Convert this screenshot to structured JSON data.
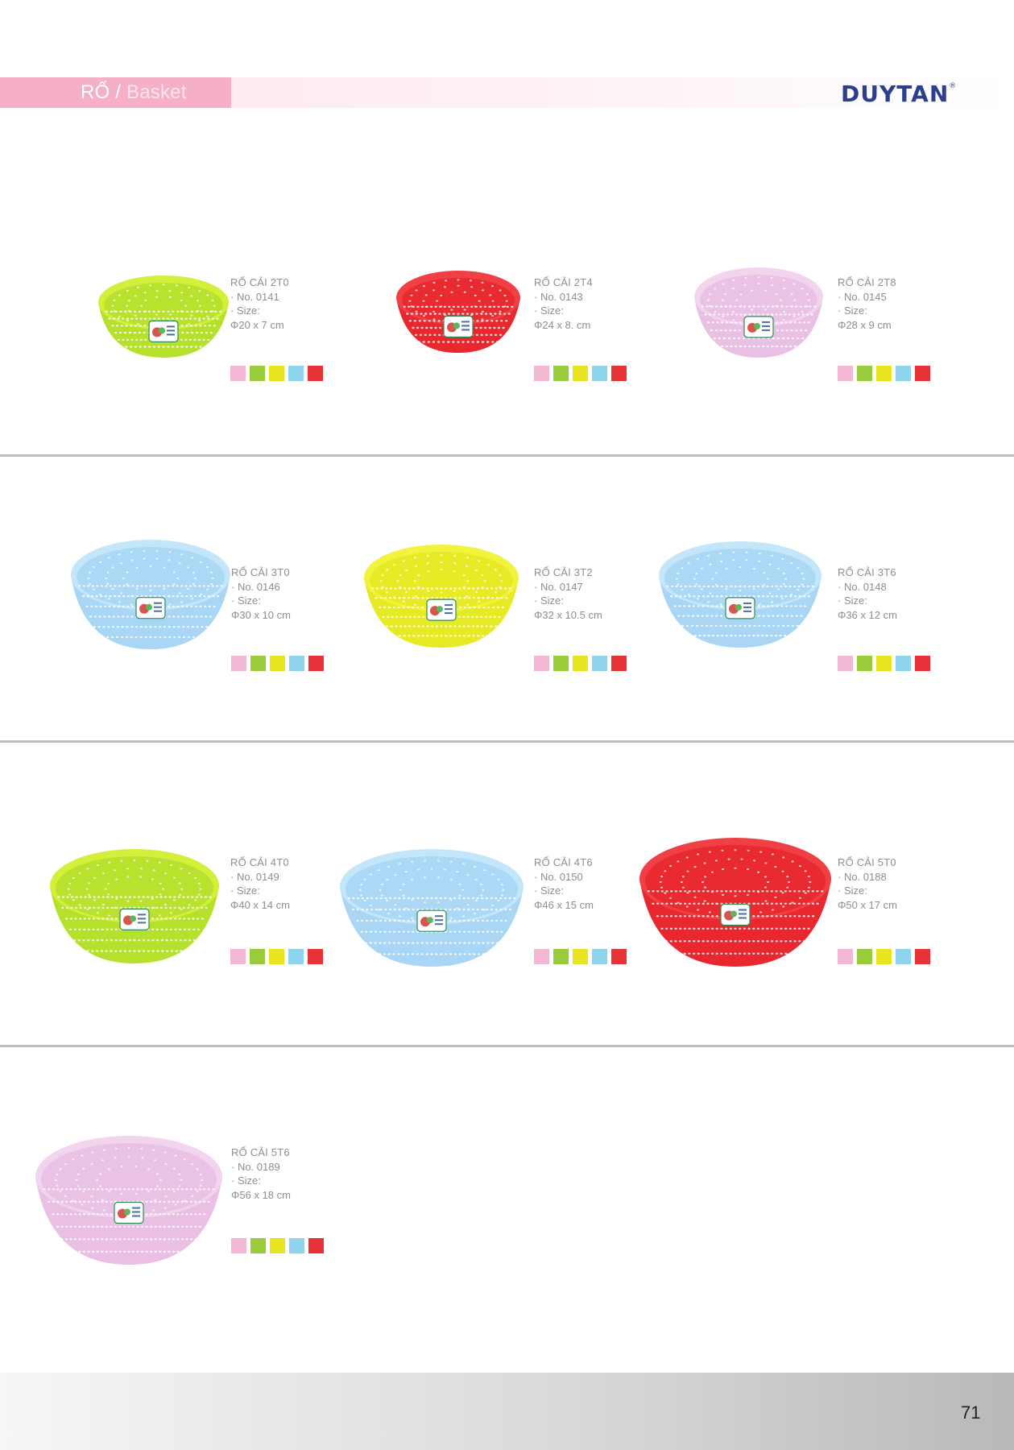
{
  "header": {
    "title_vi": "RỔ",
    "title_sep": " / ",
    "title_en": "Basket",
    "brand": "DUYTAN",
    "brand_mark": "®"
  },
  "colors": {
    "pink": "#f2b8d3",
    "green": "#9acb3b",
    "yellow": "#e8e41f",
    "blue": "#8fd4ee",
    "red": "#e8323a"
  },
  "products": [
    {
      "name": "RỔ CẢI 2T0",
      "number": "· No. 0141",
      "size_label": "· Size:",
      "size": " Φ20 x 7 cm",
      "color": "#b5e02c",
      "rim": "#d3ef3a"
    },
    {
      "name": "RỔ CẢI 2T4",
      "number": "· No. 0143",
      "size_label": "· Size:",
      "size": " Φ24 x 8. cm",
      "color": "#e8282e",
      "rim": "#f04046"
    },
    {
      "name": "RỔ CẢI 2T8",
      "number": "· No. 0145",
      "size_label": "· Size:",
      "size": " Φ28 x 9 cm",
      "color": "#e9c0e4",
      "rim": "#f3d4ef"
    },
    {
      "name": "RỔ CẢI 3T0",
      "number": "· No. 0146",
      "size_label": "· Size:",
      "size": " Φ30 x 10 cm",
      "color": "#a8d6f4",
      "rim": "#c4e6fa"
    },
    {
      "name": "RỔ CẢI 3T2",
      "number": "· No. 0147",
      "size_label": "· Size:",
      "size": " Φ32 x 10.5 cm",
      "color": "#e6ea23",
      "rim": "#f2f33c"
    },
    {
      "name": "RỔ CẢI 3T6",
      "number": "· No. 0148",
      "size_label": "· Size:",
      "size": " Φ36 x 12 cm",
      "color": "#a8d6f4",
      "rim": "#c4e6fa"
    },
    {
      "name": "RỔ CẢI 4T0",
      "number": "· No. 0149",
      "size_label": "· Size:",
      "size": " Φ40 x 14 cm",
      "color": "#b5e02c",
      "rim": "#d3ef3a"
    },
    {
      "name": "RỔ CẢI 4T6",
      "number": "· No. 0150",
      "size_label": "· Size:",
      "size": " Φ46 x 15 cm",
      "color": "#a8d6f4",
      "rim": "#c4e6fa"
    },
    {
      "name": "RỔ CẢI 5T0",
      "number": "· No. 0188",
      "size_label": "· Size:",
      "size": " Φ50 x 17 cm",
      "color": "#e8282e",
      "rim": "#f04046"
    },
    {
      "name": "RỔ CẢI 5T6",
      "number": "· No. 0189",
      "size_label": "· Size:",
      "size": " Φ56 x 18 cm",
      "color": "#e9c0e4",
      "rim": "#f3d4ef"
    }
  ],
  "page_number": "71"
}
